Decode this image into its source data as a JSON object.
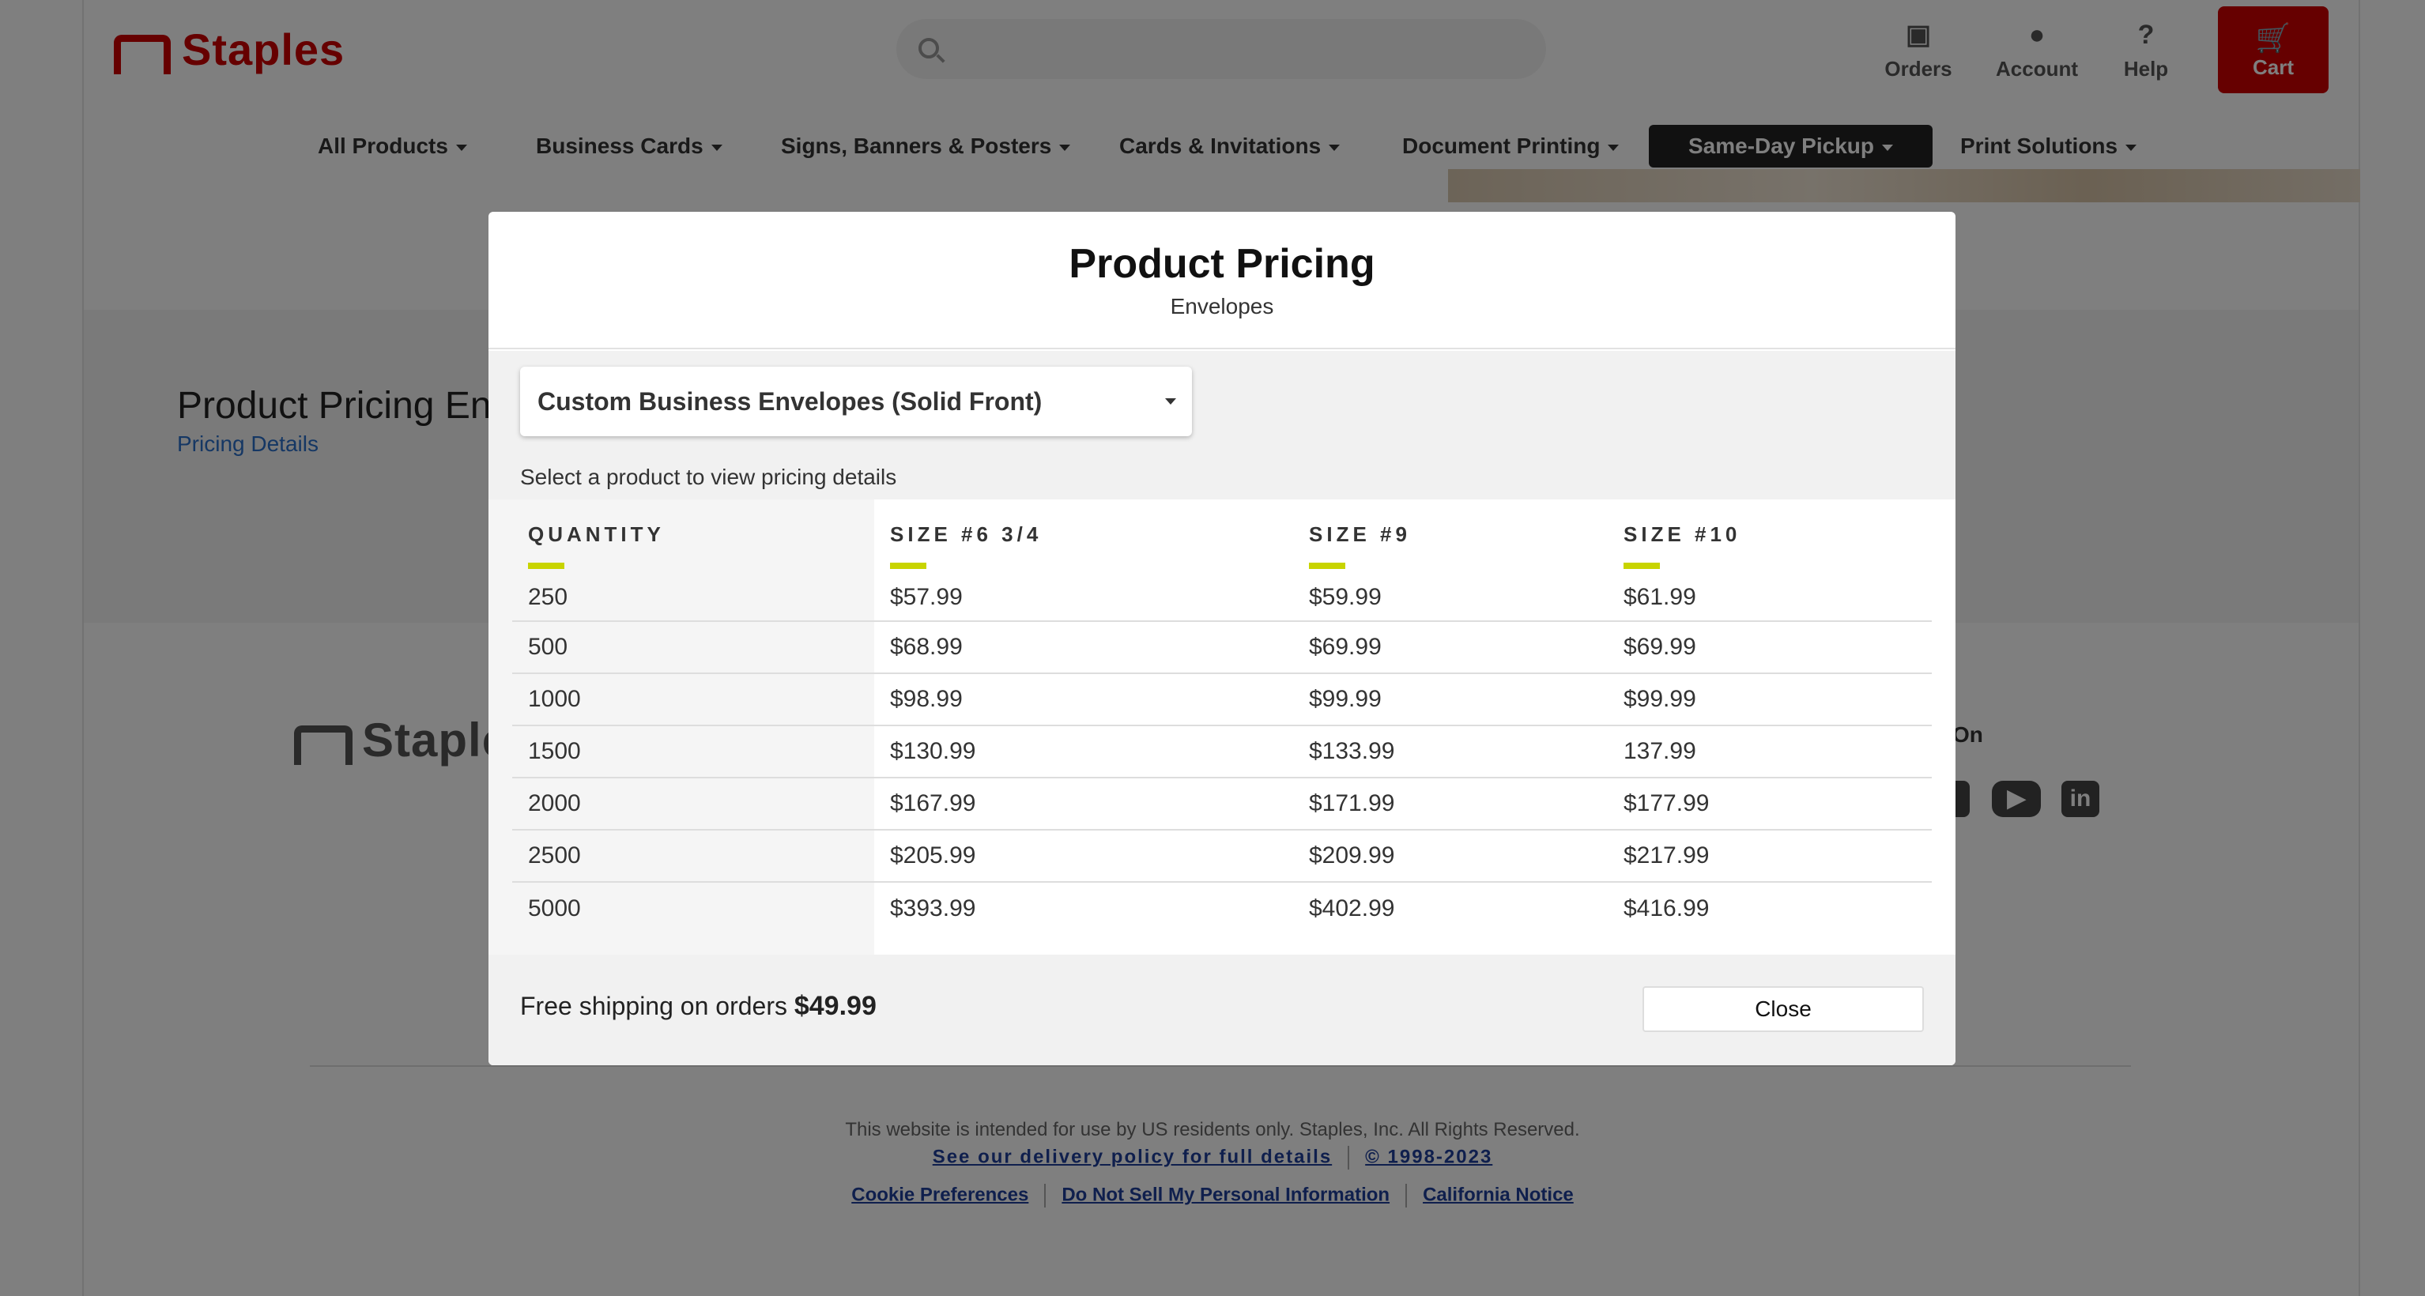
{
  "header": {
    "brand": "Staples",
    "orders_label": "Orders",
    "account_label": "Account",
    "help_label": "Help",
    "cart_label": "Cart",
    "icons": [
      "search-icon",
      "orders-icon",
      "account-icon",
      "help-icon",
      "cart-icon"
    ]
  },
  "nav": {
    "items": [
      {
        "label": "All Products"
      },
      {
        "label": "Business Cards"
      },
      {
        "label": "Signs, Banners & Posters"
      },
      {
        "label": "Cards & Invitations"
      },
      {
        "label": "Document Printing"
      },
      {
        "label": "Same-Day Pickup"
      },
      {
        "label": "Print Solutions"
      }
    ]
  },
  "background": {
    "page_title": "Product Pricing En",
    "pricing_link": "Pricing Details",
    "footer_brand": "Staples",
    "follow_label": "On",
    "social_icons": [
      "facebook-icon",
      "youtube-icon",
      "linkedin-icon"
    ],
    "legal_text": "This website is intended for use by US residents only. Staples, Inc. All Rights Reserved.",
    "delivery_link": "See our delivery policy for full details",
    "copyright": "© 1998-2023",
    "cookie_link": "Cookie Preferences",
    "do_not_sell_link": "Do Not Sell My Personal Information",
    "california_link": "California Notice"
  },
  "modal": {
    "title": "Product Pricing",
    "subtitle": "Envelopes",
    "selected_product": "Custom Business Envelopes (Solid Front)",
    "select_hint": "Select a product to view pricing details",
    "columns": [
      "QUANTITY",
      "SIZE #6 3/4",
      "SIZE #9",
      "SIZE #10"
    ],
    "rows": [
      [
        "250",
        "$57.99",
        "$59.99",
        "$61.99"
      ],
      [
        "500",
        "$68.99",
        "$69.99",
        "$69.99"
      ],
      [
        "1000",
        "$98.99",
        "$99.99",
        "$99.99"
      ],
      [
        "1500",
        "$130.99",
        "$133.99",
        "137.99"
      ],
      [
        "2000",
        "$167.99",
        "$171.99",
        "$177.99"
      ],
      [
        "2500",
        "$205.99",
        "$209.99",
        "$217.99"
      ],
      [
        "5000",
        "$393.99",
        "$402.99",
        "$416.99"
      ]
    ],
    "shipping_text": "Free shipping on orders",
    "shipping_amount": "$49.99",
    "close_label": "Close"
  },
  "colors": {
    "brand_red": "#cc0000",
    "accent_lime": "#c8d400",
    "link_blue": "#1f3f9a"
  }
}
